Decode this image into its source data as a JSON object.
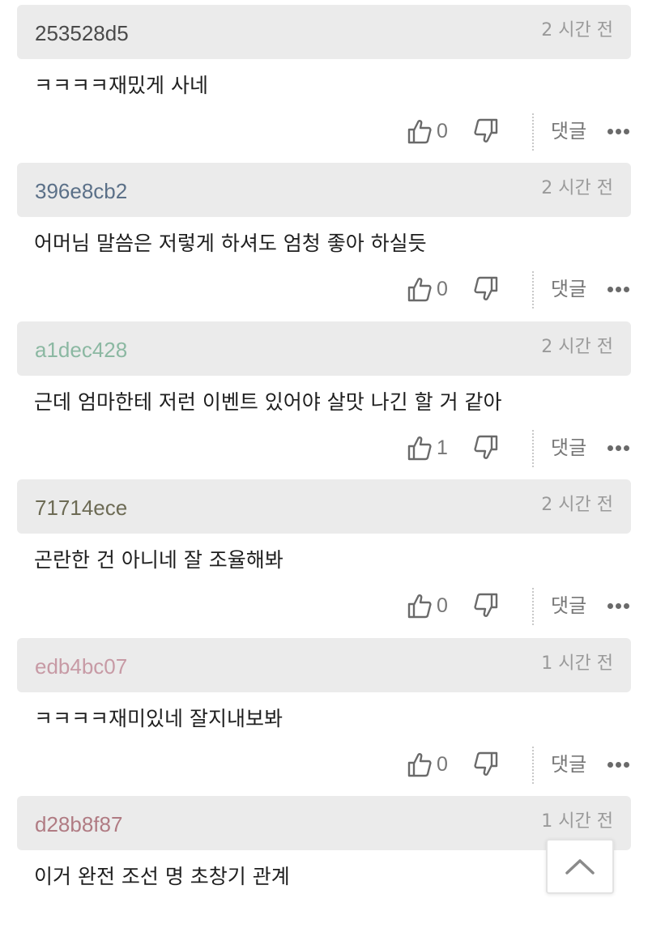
{
  "comments": [
    {
      "author": "253528d5",
      "author_color": "#4a4a4a",
      "time": "2 시간 전",
      "text": "ㅋㅋㅋㅋ재밌게 사네",
      "likes": "0",
      "reply_label": "댓글"
    },
    {
      "author": "396e8cb2",
      "author_color": "#5b7088",
      "time": "2 시간 전",
      "text": "어머님 말씀은 저렇게 하셔도 엄청 좋아 하실듯",
      "likes": "0",
      "reply_label": "댓글"
    },
    {
      "author": "a1dec428",
      "author_color": "#8bb8a2",
      "time": "2 시간 전",
      "text": "근데 엄마한테 저런 이벤트 있어야 살맛 나긴 할 거 같아",
      "likes": "1",
      "reply_label": "댓글"
    },
    {
      "author": "71714ece",
      "author_color": "#6d6b55",
      "time": "2 시간 전",
      "text": "곤란한 건 아니네 잘 조율해봐",
      "likes": "0",
      "reply_label": "댓글"
    },
    {
      "author": "edb4bc07",
      "author_color": "#c79aa5",
      "time": "1 시간 전",
      "text": "ㅋㅋㅋㅋ재미있네 잘지내보봐",
      "likes": "0",
      "reply_label": "댓글"
    },
    {
      "author": "d28b8f87",
      "author_color": "#b07b83",
      "time": "1 시간 전",
      "text": "이거 완전 조선 명 초창기 관계"
    }
  ],
  "icons": {
    "like": "thumbs-up-icon",
    "dislike": "thumbs-down-icon",
    "more": "more-dots-icon",
    "scroll_top": "chevron-up-icon"
  }
}
